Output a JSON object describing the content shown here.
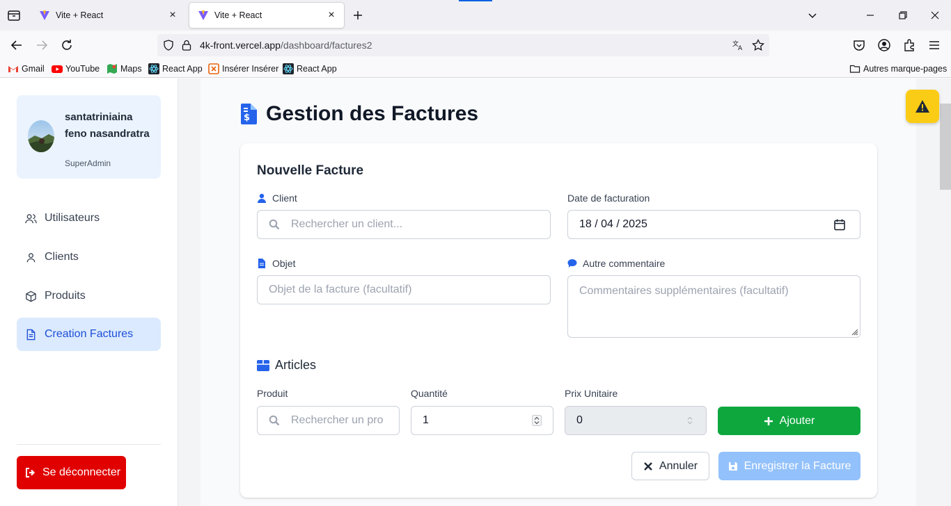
{
  "browser": {
    "tabs": [
      {
        "title": "Vite + React",
        "active": false
      },
      {
        "title": "Vite + React",
        "active": true
      }
    ],
    "url": {
      "domain": "4k-front.vercel.app",
      "path": "/dashboard/factures2"
    },
    "bookmarks": [
      {
        "label": "Gmail",
        "icon": "gmail-icon"
      },
      {
        "label": "YouTube",
        "icon": "youtube-icon"
      },
      {
        "label": "Maps",
        "icon": "maps-icon"
      },
      {
        "label": "React App",
        "icon": "react-icon"
      },
      {
        "label": "Insérer Insérer",
        "icon": "bookmark-icon"
      },
      {
        "label": "React App",
        "icon": "react-icon"
      }
    ],
    "other_bookmarks": "Autres marque-pages"
  },
  "sidebar": {
    "user": {
      "name": "santatriniaina feno nasandratra",
      "role": "SuperAdmin"
    },
    "items": [
      {
        "label": "Utilisateurs",
        "icon": "users-icon",
        "active": false
      },
      {
        "label": "Clients",
        "icon": "user-icon",
        "active": false
      },
      {
        "label": "Produits",
        "icon": "box-icon",
        "active": false
      },
      {
        "label": "Creation Factures",
        "icon": "document-icon",
        "active": true
      }
    ],
    "logout": "Se déconnecter"
  },
  "main": {
    "title": "Gestion des Factures",
    "form": {
      "title": "Nouvelle Facture",
      "client": {
        "label": "Client",
        "placeholder": "Rechercher un client..."
      },
      "date": {
        "label": "Date de facturation",
        "value": "18 / 04 / 2025"
      },
      "objet": {
        "label": "Objet",
        "placeholder": "Objet de la facture (facultatif)"
      },
      "commentaire": {
        "label": "Autre commentaire",
        "placeholder": "Commentaires supplémentaires (facultatif)"
      },
      "articles": {
        "title": "Articles",
        "produit": {
          "label": "Produit",
          "placeholder": "Rechercher un pro"
        },
        "quantite": {
          "label": "Quantité",
          "value": "1"
        },
        "prix": {
          "label": "Prix Unitaire",
          "value": "0"
        },
        "add_button": "Ajouter"
      },
      "cancel_button": "Annuler",
      "save_button": "Enregistrer la Facture"
    }
  },
  "colors": {
    "primary": "#2563eb",
    "success": "#0da73e",
    "danger": "#e00000",
    "warning": "#facc15"
  }
}
